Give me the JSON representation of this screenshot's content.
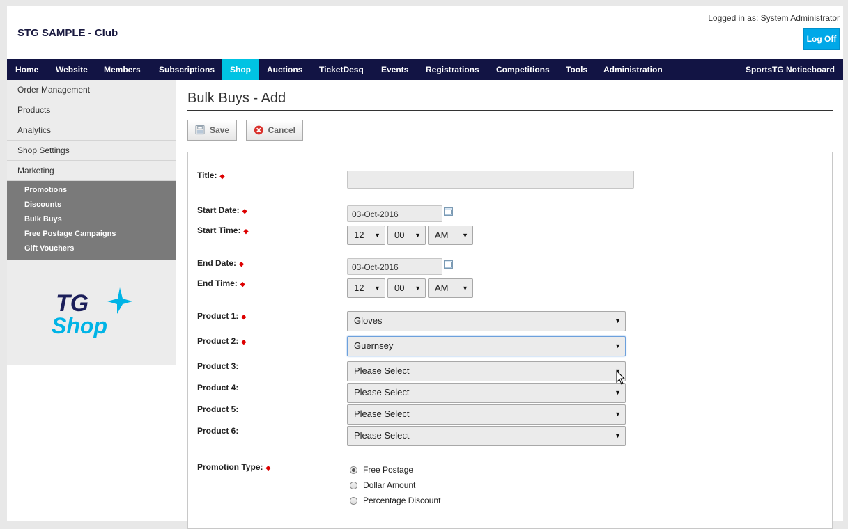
{
  "header": {
    "club_title": "STG SAMPLE - Club",
    "logged_in_text": "Logged in as: System Administrator",
    "logoff_label": "Log Off"
  },
  "topnav": {
    "items": [
      "Home",
      "Website",
      "Members",
      "Subscriptions",
      "Shop",
      "Auctions",
      "TicketDesq",
      "Events",
      "Registrations",
      "Competitions",
      "Tools",
      "Administration"
    ],
    "active": "Shop",
    "right_item": "SportsTG Noticeboard",
    "bg_color": "#121444",
    "active_color": "#00c3e3"
  },
  "sidebar": {
    "items": [
      "Order Management",
      "Products",
      "Analytics",
      "Shop Settings",
      "Marketing"
    ],
    "subitems": [
      "Promotions",
      "Discounts",
      "Bulk Buys",
      "Free Postage Campaigns",
      "Gift Vouchers"
    ],
    "logo": {
      "line1": "TG",
      "line2": "Shop",
      "icon": "star-icon"
    }
  },
  "main": {
    "title": "Bulk Buys - Add",
    "save_label": "Save",
    "cancel_label": "Cancel"
  },
  "form": {
    "title_label": "Title:",
    "title_value": "",
    "start_date_label": "Start Date:",
    "start_date_value": "03-Oct-2016",
    "start_time_label": "Start Time:",
    "start_hour": "12",
    "start_minute": "00",
    "start_ampm": "AM",
    "end_date_label": "End Date:",
    "end_date_value": "03-Oct-2016",
    "end_time_label": "End Time:",
    "end_hour": "12",
    "end_minute": "00",
    "end_ampm": "AM",
    "products": [
      {
        "label": "Product 1:",
        "value": "Gloves",
        "required": true
      },
      {
        "label": "Product 2:",
        "value": "Guernsey",
        "required": true
      },
      {
        "label": "Product 3:",
        "value": "Please Select",
        "required": false
      },
      {
        "label": "Product 4:",
        "value": "Please Select",
        "required": false
      },
      {
        "label": "Product 5:",
        "value": "Please Select",
        "required": false
      },
      {
        "label": "Product 6:",
        "value": "Please Select",
        "required": false
      }
    ],
    "promotion_type_label": "Promotion Type:",
    "promotion_options": [
      "Free Postage",
      "Dollar Amount",
      "Percentage Discount"
    ],
    "promotion_selected": "Free Postage",
    "required_marker": "◆"
  }
}
